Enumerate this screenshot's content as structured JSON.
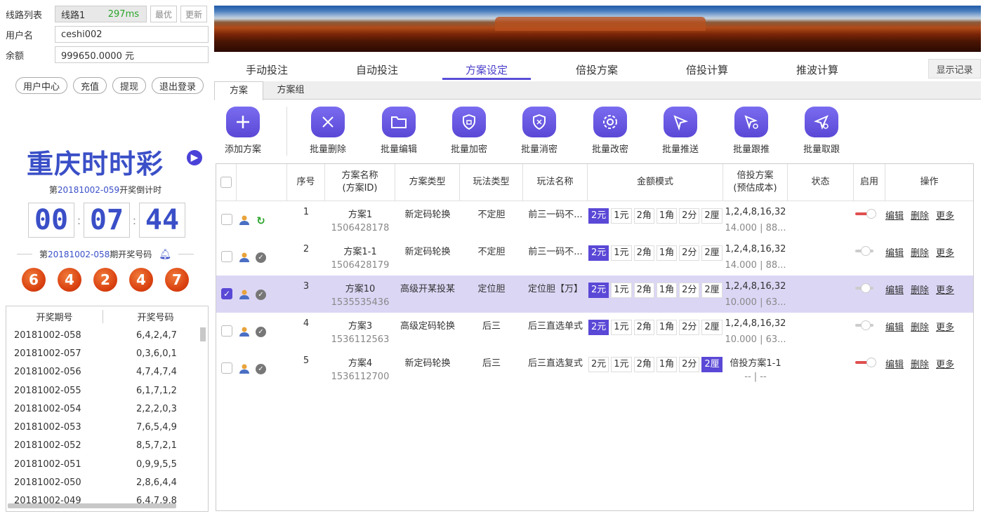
{
  "left": {
    "route_label": "线路列表",
    "route_name": "线路1",
    "route_ms": "297ms",
    "best_btn": "最优",
    "refresh_btn": "更新",
    "user_label": "用户名",
    "user_value": "ceshi002",
    "balance_label": "余额",
    "balance_value": "999650.0000 元",
    "actions": [
      "用户中心",
      "充值",
      "提现",
      "退出登录"
    ],
    "lottery_title": "重庆时时彩",
    "countdown_prefix": "第",
    "countdown_period": "20181002-059",
    "countdown_suffix": "开奖倒计时",
    "timer": [
      "00",
      "07",
      "44"
    ],
    "prev_prefix": "第",
    "prev_period": "20181002-058",
    "prev_suffix": "期开奖号码",
    "balls": [
      "6",
      "4",
      "2",
      "4",
      "7"
    ],
    "history_headers": [
      "开奖期号",
      "开奖号码"
    ],
    "history": [
      [
        "20181002-058",
        "6,4,2,4,7"
      ],
      [
        "20181002-057",
        "0,3,6,0,1"
      ],
      [
        "20181002-056",
        "4,7,4,7,4"
      ],
      [
        "20181002-055",
        "6,1,7,1,2"
      ],
      [
        "20181002-054",
        "2,2,2,0,3"
      ],
      [
        "20181002-053",
        "7,6,5,4,9"
      ],
      [
        "20181002-052",
        "8,5,7,2,1"
      ],
      [
        "20181002-051",
        "0,9,9,5,5"
      ],
      [
        "20181002-050",
        "2,8,6,4,4"
      ],
      [
        "20181002-049",
        "6,4,7,9,8"
      ]
    ]
  },
  "tabs": [
    "手动投注",
    "自动投注",
    "方案设定",
    "倍投方案",
    "倍投计算",
    "推波计算"
  ],
  "active_tab": "方案设定",
  "show_record": "显示记录",
  "subtabs": [
    "方案",
    "方案组"
  ],
  "toolbar": [
    "添加方案",
    "批量删除",
    "批量编辑",
    "批量加密",
    "批量消密",
    "批量改密",
    "批量推送",
    "批量跟推",
    "批量取跟"
  ],
  "table": {
    "headers": {
      "seq": "序号",
      "name_1": "方案名称",
      "name_2": "(方案ID)",
      "type": "方案类型",
      "play_type": "玩法类型",
      "play_name": "玩法名称",
      "amount_mode": "金额模式",
      "multi_1": "倍投方案",
      "multi_2": "(预估成本)",
      "status": "状态",
      "enable": "启用",
      "ops": "操作"
    },
    "amount_options": [
      "2元",
      "1元",
      "2角",
      "1角",
      "2分",
      "2厘"
    ],
    "op_labels": [
      "编辑",
      "删除",
      "更多"
    ],
    "rows": [
      {
        "seq": "1",
        "name": "方案1",
        "id": "1506428178",
        "type": "新定码轮换",
        "play_type": "不定胆",
        "play_name": "前三一码不...",
        "amount": "2元",
        "multi": "1,2,4,8,16,32",
        "cost": "14.000 | 88...",
        "enabled": true,
        "selected": false,
        "status": "running"
      },
      {
        "seq": "2",
        "name": "方案1-1",
        "id": "1506428179",
        "type": "新定码轮换",
        "play_type": "不定胆",
        "play_name": "前三一码不...",
        "amount": "2元",
        "multi": "1,2,4,8,16,32",
        "cost": "14.000 | 88...",
        "enabled": false,
        "selected": false,
        "status": "done"
      },
      {
        "seq": "3",
        "name": "方案10",
        "id": "1535535436",
        "type": "高级开某投某",
        "play_type": "定位胆",
        "play_name": "定位胆【万】",
        "amount": "2元",
        "multi": "1,2,4,8,16,32",
        "cost": "10.000 | 63...",
        "enabled": false,
        "selected": true,
        "status": "done"
      },
      {
        "seq": "4",
        "name": "方案3",
        "id": "1536112563",
        "type": "高级定码轮换",
        "play_type": "后三",
        "play_name": "后三直选单式",
        "amount": "2元",
        "multi": "1,2,4,8,16,32",
        "cost": "10.000 | 63...",
        "enabled": false,
        "selected": false,
        "status": "done"
      },
      {
        "seq": "5",
        "name": "方案4",
        "id": "1536112700",
        "type": "新定码轮换",
        "play_type": "后三",
        "play_name": "后三直选复式",
        "amount": "2厘",
        "multi": "倍投方案1-1",
        "cost": "-- | --",
        "enabled": true,
        "selected": false,
        "status": "done"
      }
    ]
  },
  "colors": {
    "accent": "#5a48d6",
    "title_blue": "#3a4fc7",
    "ball": "#d9400f",
    "selected_row": "#dcd6f5"
  }
}
